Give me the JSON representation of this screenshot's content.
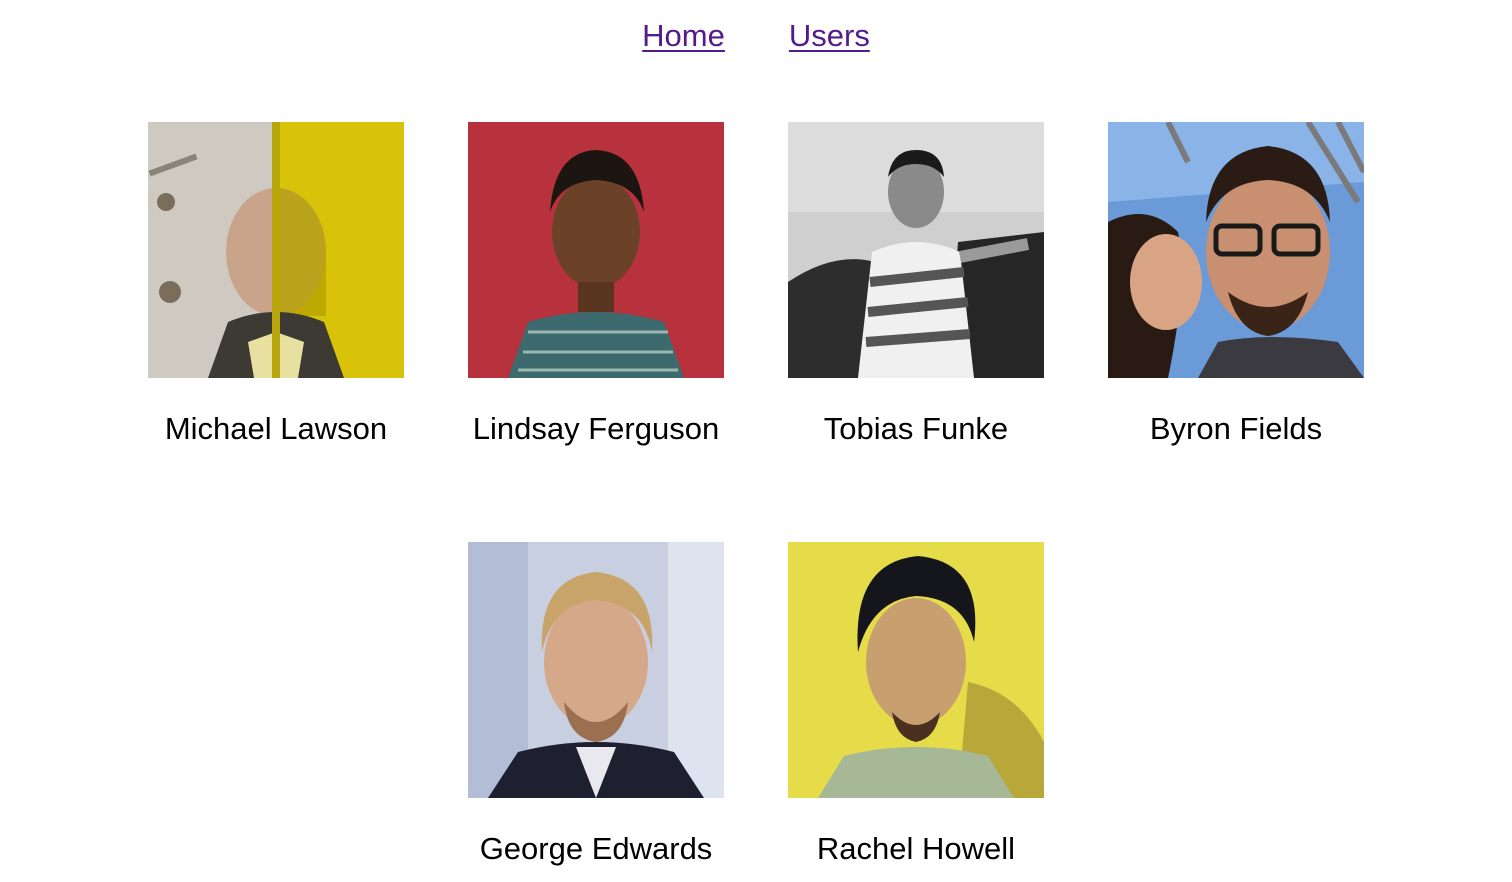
{
  "nav": {
    "links": [
      {
        "label": "Home"
      },
      {
        "label": "Users"
      }
    ],
    "link_color": "#551a8b"
  },
  "users": [
    {
      "name": "Michael Lawson",
      "avatar": "michael-lawson-photo"
    },
    {
      "name": "Lindsay Ferguson",
      "avatar": "lindsay-ferguson-photo"
    },
    {
      "name": "Tobias Funke",
      "avatar": "tobias-funke-photo"
    },
    {
      "name": "Byron Fields",
      "avatar": "byron-fields-photo"
    },
    {
      "name": "George Edwards",
      "avatar": "george-edwards-photo"
    },
    {
      "name": "Rachel Howell",
      "avatar": "rachel-howell-photo"
    }
  ]
}
